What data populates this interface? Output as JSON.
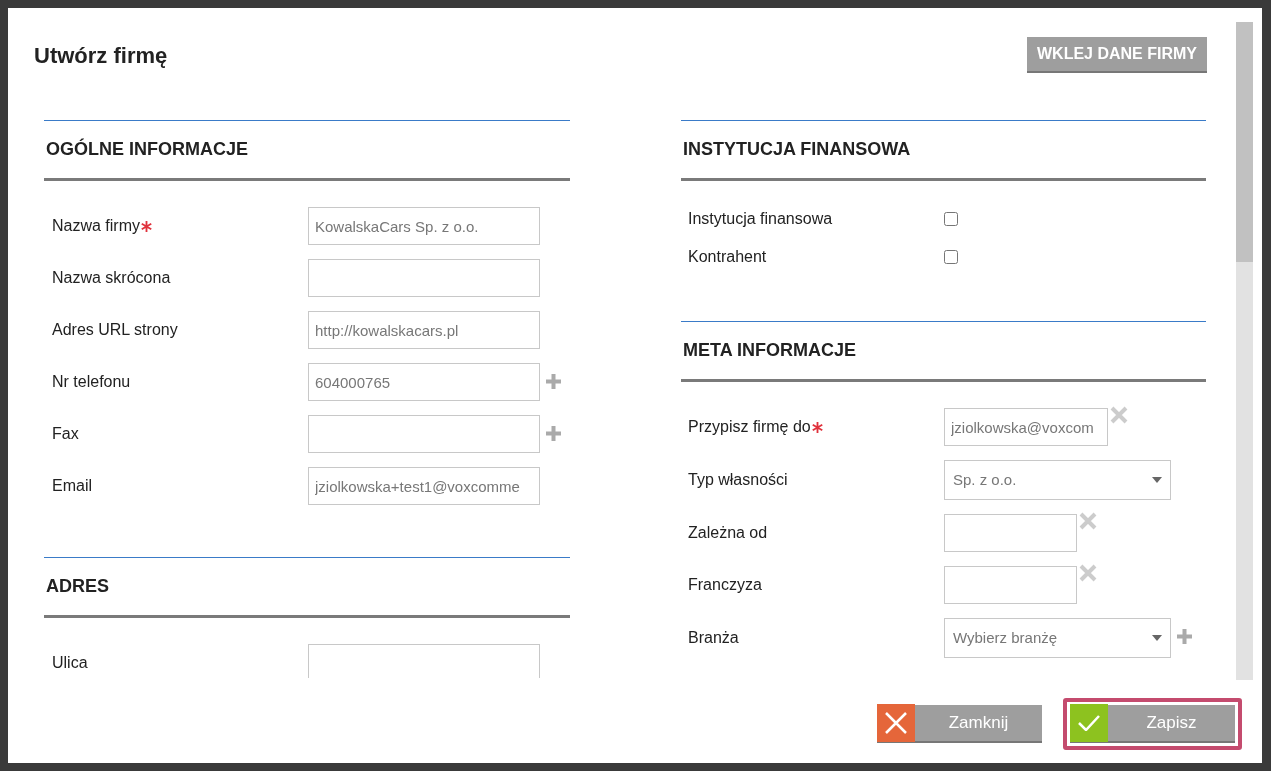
{
  "dialog": {
    "title": "Utwórz firmę",
    "paste_button": "WKLEJ DANE FIRMY"
  },
  "left_sections": [
    {
      "heading": "OGÓLNE INFORMACJE",
      "fields": [
        {
          "kind": "text",
          "label": "Nazwa firmy",
          "required": true,
          "value": "KowalskaCars Sp. z o.o."
        },
        {
          "kind": "text",
          "label": "Nazwa skrócona",
          "required": false
        },
        {
          "kind": "text",
          "label": "Adres URL strony",
          "required": false,
          "value": "http://kowalskacars.pl"
        },
        {
          "kind": "text",
          "label": "Nr telefonu",
          "required": false,
          "value": "604000765",
          "add_button": true
        },
        {
          "kind": "text",
          "label": "Fax",
          "required": false,
          "add_button": true
        },
        {
          "kind": "text",
          "label": "Email",
          "required": false,
          "value": "jziolkowska+test1@voxcomme"
        }
      ]
    },
    {
      "heading": "ADRES",
      "fields": [
        {
          "kind": "text",
          "label": "Ulica",
          "required": false
        }
      ]
    }
  ],
  "right_sections": [
    {
      "heading": "INSTYTUCJA FINANSOWA",
      "fields": [
        {
          "kind": "checkbox",
          "label": "Instytucja finansowa",
          "checked": false
        },
        {
          "kind": "checkbox",
          "label": "Kontrahent",
          "checked": false
        }
      ]
    },
    {
      "heading": "META INFORMACJE",
      "fields": [
        {
          "kind": "short",
          "label": "Przypisz firmę do",
          "required": true,
          "value": "jziolkowska@voxcom",
          "clear_button": true
        },
        {
          "kind": "select",
          "label": "Typ własności",
          "required": false,
          "value": "Sp. z o.o."
        },
        {
          "kind": "narrow",
          "label": "Zależna od",
          "required": false,
          "clear_button": true
        },
        {
          "kind": "narrow",
          "label": "Franczyza",
          "required": false,
          "clear_button": true
        },
        {
          "kind": "select",
          "label": "Branża",
          "required": false,
          "placeholder": "Wybierz branżę",
          "add_button": true
        }
      ]
    }
  ],
  "footer": [
    {
      "kind": "close",
      "label": "Zamknij",
      "highlighted": false
    },
    {
      "kind": "save",
      "label": "Zapisz",
      "highlighted": true
    }
  ]
}
